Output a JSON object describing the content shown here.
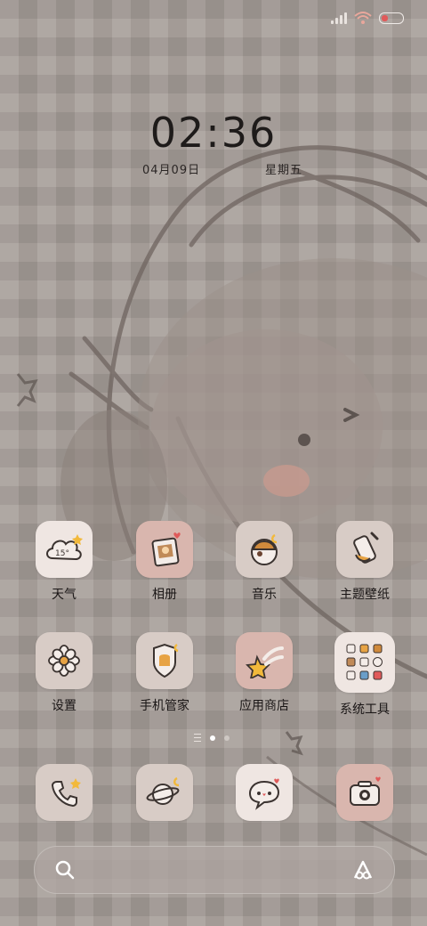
{
  "status_bar": {
    "icons": [
      "signal-icon",
      "wifi-icon",
      "battery-icon"
    ],
    "battery_color": "#e05a5a"
  },
  "lock": {
    "time": "02:36",
    "date": "04月09日",
    "weekday": "星期五"
  },
  "apps": [
    {
      "label": "天气",
      "icon": "weather-cloud-icon",
      "badge": "15°"
    },
    {
      "label": "相册",
      "icon": "photo-frame-icon"
    },
    {
      "label": "音乐",
      "icon": "music-icon"
    },
    {
      "label": "主题壁纸",
      "icon": "paint-brush-icon"
    },
    {
      "label": "设置",
      "icon": "flower-settings-icon"
    },
    {
      "label": "手机管家",
      "icon": "shield-icon"
    },
    {
      "label": "应用商店",
      "icon": "shooting-star-icon"
    },
    {
      "label": "系统工具",
      "icon": "folder-icon"
    }
  ],
  "dock": [
    {
      "icon": "phone-icon"
    },
    {
      "icon": "planet-browser-icon"
    },
    {
      "icon": "chat-bubble-icon"
    },
    {
      "icon": "camera-icon"
    }
  ],
  "search": {
    "icons": [
      "search-icon",
      "assistant-icon"
    ]
  },
  "colors": {
    "background": "#a39a95",
    "tile": "#d8ccc6",
    "tile_pink": "#d9b6ae",
    "accent_star": "#f2b93b"
  }
}
